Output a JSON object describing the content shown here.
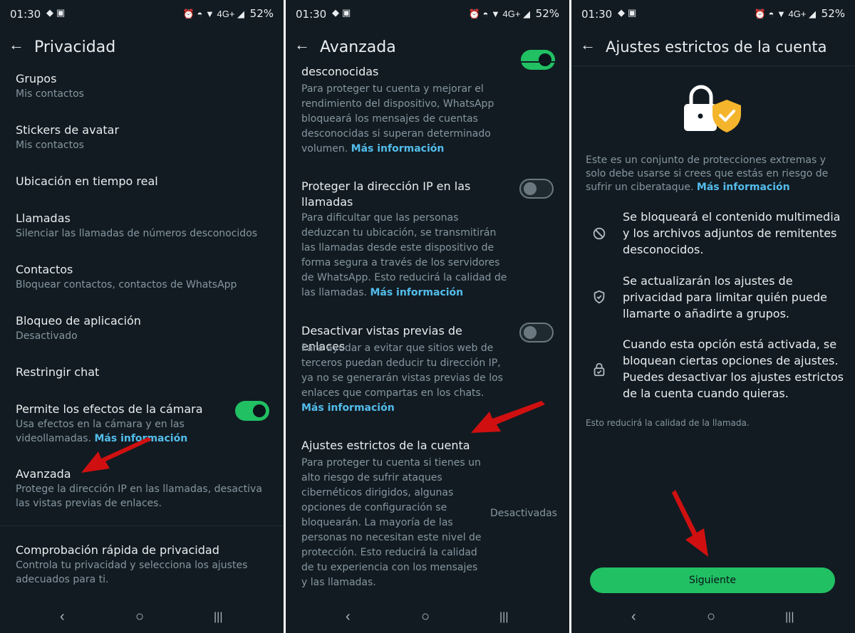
{
  "status": {
    "time": "01:30",
    "battery": "52%",
    "network": "4G+"
  },
  "panel1": {
    "title": "Privacidad",
    "items": [
      {
        "title": "Grupos",
        "sub": "Mis contactos"
      },
      {
        "title": "Stickers de avatar",
        "sub": "Mis contactos"
      },
      {
        "title": "Ubicación en tiempo real",
        "sub": ""
      },
      {
        "title": "Llamadas",
        "sub": "Silenciar las llamadas de números desconocidos"
      },
      {
        "title": "Contactos",
        "sub": "Bloquear contactos, contactos de WhatsApp"
      },
      {
        "title": "Bloqueo de aplicación",
        "sub": "Desactivado"
      },
      {
        "title": "Restringir chat",
        "sub": ""
      },
      {
        "title": "Permite los efectos de la cámara",
        "sub": "Usa efectos en la cámara y en las videollamadas.",
        "link": "Más información",
        "toggle": "on"
      },
      {
        "title": "Avanzada",
        "sub": "Protege la dirección IP en las llamadas, desactiva las vistas previas de enlaces."
      },
      {
        "title": "Comprobación rápida de privacidad",
        "sub": "Controla tu privacidad y selecciona los ajustes adecuados para ti."
      }
    ]
  },
  "panel2": {
    "title": "Avanzada",
    "top_title": "desconocidas",
    "top_sub": "Para proteger tu cuenta y mejorar el rendimiento del dispositivo, WhatsApp bloqueará los mensajes de cuentas desconocidas si superan determinado volumen.",
    "top_link": "Más información",
    "ip_title": "Proteger la dirección IP en las llamadas",
    "ip_sub": "Para dificultar que las personas deduzcan tu ubicación, se transmitirán las llamadas desde este dispositivo de forma segura a través de los servidores de WhatsApp. Esto reducirá la calidad de las llamadas.",
    "ip_link": "Más información",
    "preview_title": "Desactivar vistas previas de enlaces",
    "preview_sub": "Para ayudar a evitar que sitios web de terceros puedan deducir tu dirección IP, ya no se generarán vistas previas de los enlaces que compartas en los chats.",
    "preview_link": "Más información",
    "strict_title": "Ajustes estrictos de la cuenta",
    "strict_sub": "Para proteger tu cuenta si tienes un alto riesgo de sufrir ataques cibernéticos dirigidos, algunas opciones de configuración se bloquearán. La mayoría de las personas no necesitan este nivel de protección. Esto reducirá la calidad de tu experiencia con los mensajes y las llamadas.",
    "strict_value": "Desactivadas"
  },
  "panel3": {
    "title": "Ajustes estrictos de la cuenta",
    "intro": "Este es un conjunto de protecciones extremas y solo debe usarse si crees que estás en riesgo de sufrir un ciberataque.",
    "intro_link": "Más información",
    "features": [
      {
        "icon": "block-icon",
        "text": "Se bloqueará el contenido multimedia y los archivos adjuntos de remitentes desconocidos."
      },
      {
        "icon": "shield-check-icon",
        "text": "Se actualizarán los ajustes de privacidad para limitar quién puede llamarte o añadirte a grupos."
      },
      {
        "icon": "lock-check-icon",
        "text": "Cuando esta opción está activada, se bloquean ciertas opciones de ajustes. Puedes desactivar los ajustes estrictos de la cuenta cuando quieras."
      }
    ],
    "note": "Esto reducirá la calidad de la llamada.",
    "button": "Siguiente"
  },
  "colors": {
    "background": "#121b22",
    "accent": "#21c063",
    "link": "#53bdeb",
    "annotation_arrow": "#d01010"
  }
}
